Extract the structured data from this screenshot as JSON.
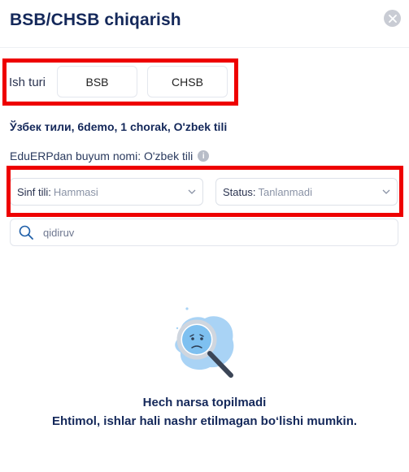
{
  "modal": {
    "title": "BSB/CHSB chiqarish"
  },
  "work_type": {
    "label": "Ish turi",
    "options": [
      "BSB",
      "CHSB"
    ]
  },
  "subject_line": "Ўзбек тили, 6demo, 1 chorak, O'zbek tili",
  "erp_line": "EduERPdan buyum nomi: O'zbek tili",
  "filters": {
    "sinf_tili": {
      "label": "Sinf tili:",
      "value": "Hammasi"
    },
    "status": {
      "label": "Status:",
      "value": "Tanlanmadi"
    }
  },
  "search": {
    "placeholder": "qidiruv"
  },
  "empty_state": {
    "title": "Hech narsa topilmadi",
    "subtitle": "Ehtimol, ishlar hali nashr etilmagan bo‘lishi mumkin."
  },
  "colors": {
    "primary_text": "#14285a",
    "highlight_border": "#ee0000",
    "illustration_blue": "#a9d3f5"
  }
}
